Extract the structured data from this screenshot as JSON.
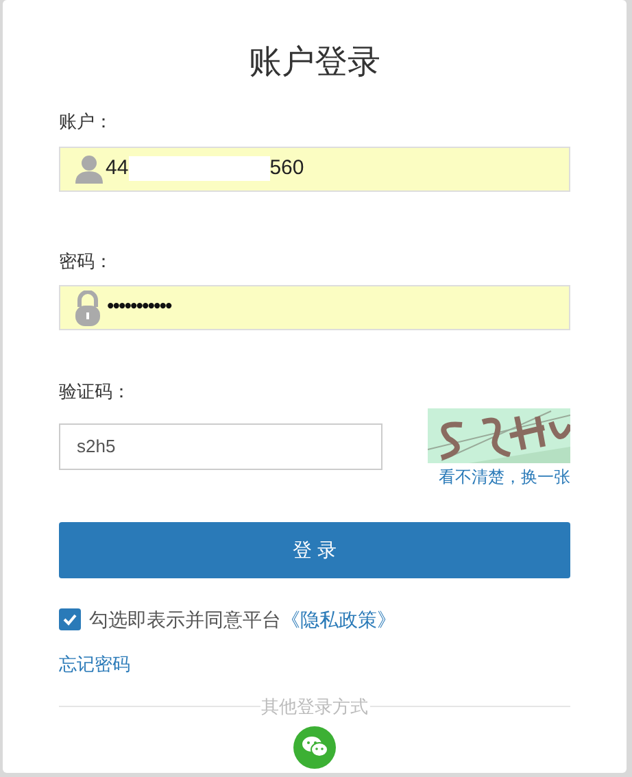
{
  "title": "账户登录",
  "account": {
    "label": "账户：",
    "value_start": "44",
    "value_end": "560",
    "redacted": true
  },
  "password": {
    "label": "密码：",
    "value": "•••••••••••"
  },
  "captcha": {
    "label": "验证码：",
    "value": "s2h5",
    "refresh_link": "看不清楚，换一张"
  },
  "login_button": "登 录",
  "agreement": {
    "checked": true,
    "text": "勾选即表示并同意平台",
    "link": "《隐私政策》"
  },
  "forgot_password": "忘记密码",
  "other_login": {
    "label": "其他登录方式"
  }
}
